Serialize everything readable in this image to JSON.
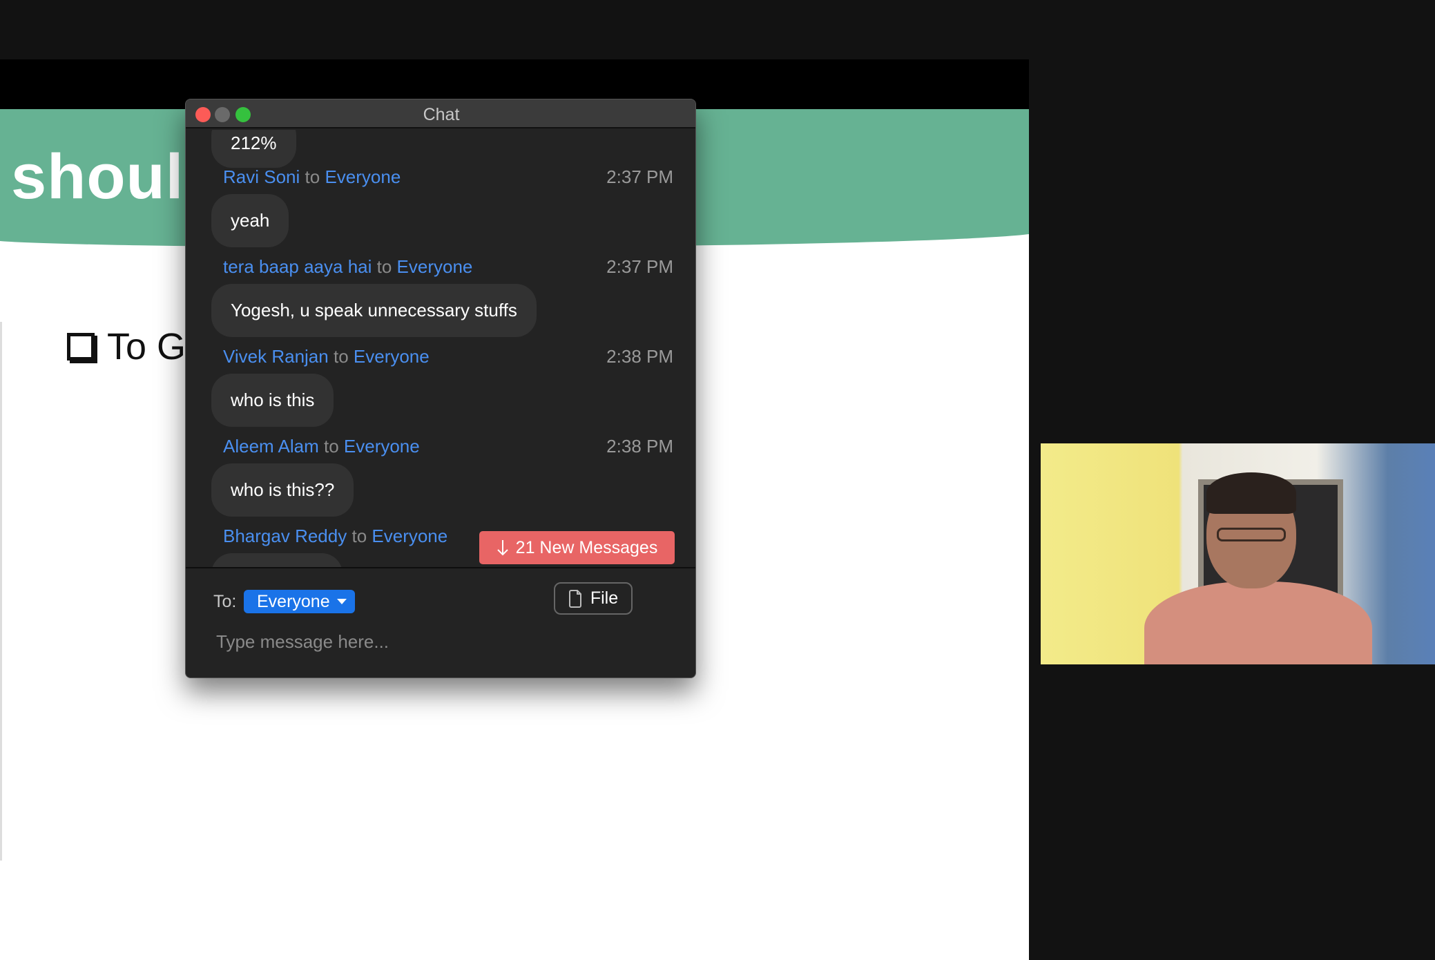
{
  "shared_screen": {
    "heading_fragment": "shoul",
    "checklist_item": "To Ga"
  },
  "chat": {
    "title": "Chat",
    "partial_top_message": "212%",
    "messages": [
      {
        "sender": "Ravi Soni",
        "to_word": "to",
        "recipient": "Everyone",
        "time": "2:37 PM",
        "text": "yeah"
      },
      {
        "sender": "tera baap aaya hai",
        "to_word": "to",
        "recipient": "Everyone",
        "time": "2:37 PM",
        "text": "Yogesh, u speak unnecessary stuffs"
      },
      {
        "sender": "Vivek Ranjan",
        "to_word": "to",
        "recipient": "Everyone",
        "time": "2:38 PM",
        "text": "who is this"
      },
      {
        "sender": "Aleem Alam",
        "to_word": "to",
        "recipient": "Everyone",
        "time": "2:38 PM",
        "text": "who is this??"
      },
      {
        "sender": "Bhargav Reddy",
        "to_word": "to",
        "recipient": "Everyone"
      }
    ],
    "new_messages_label": "21 New Messages",
    "to_label": "To:",
    "recipient_selected": "Everyone",
    "file_label": "File",
    "input_placeholder": "Type message here...",
    "colors": {
      "accent": "#1a73e8",
      "name": "#4a8ff0",
      "new_messages": "#e86565"
    }
  }
}
